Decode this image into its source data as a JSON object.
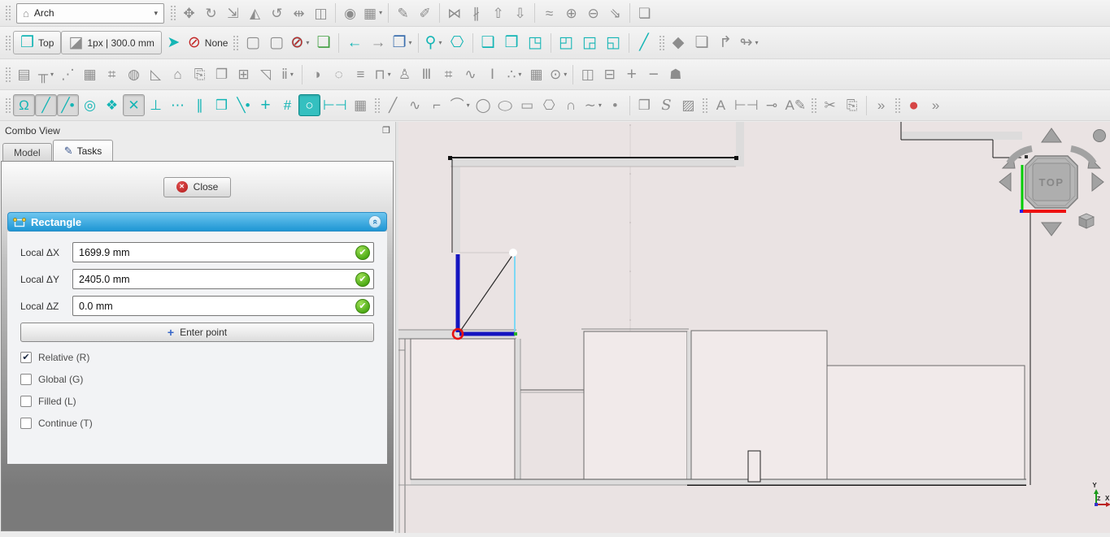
{
  "colors": {
    "teal": "#14b5b5",
    "header-blue1": "#6ec6ef",
    "header-blue2": "#1e96d4",
    "ok-green": "#4aa814",
    "record-red": "#d64545",
    "viewport-bg": "#eae3e3"
  },
  "toolbars": {
    "workbench_value": "Arch",
    "row1": [
      {
        "handle": true
      },
      {
        "name": "move-icon",
        "glyph": "✥"
      },
      {
        "name": "rotate-icon",
        "glyph": "↻"
      },
      {
        "name": "scale-icon",
        "glyph": "⇲"
      },
      {
        "name": "mirror-icon",
        "glyph": "◭"
      },
      {
        "name": "offset-icon",
        "glyph": "↺"
      },
      {
        "name": "trimex-icon",
        "glyph": "⇹"
      },
      {
        "name": "stretch-icon",
        "glyph": "◫"
      },
      {
        "sep": true
      },
      {
        "name": "clone-icon",
        "glyph": "◉"
      },
      {
        "name": "array-icon",
        "glyph": "▦",
        "dd": true
      },
      {
        "sep": true
      },
      {
        "name": "edit-icon",
        "glyph": "✎"
      },
      {
        "name": "subelement-icon",
        "glyph": "✐"
      },
      {
        "sep": true
      },
      {
        "name": "join-icon",
        "glyph": "⋈"
      },
      {
        "name": "split-icon",
        "glyph": "∦"
      },
      {
        "name": "upgrade-icon",
        "glyph": "⇧"
      },
      {
        "name": "downgrade-icon",
        "glyph": "⇩"
      },
      {
        "sep": true
      },
      {
        "name": "wire-to-bspline-icon",
        "glyph": "≈"
      },
      {
        "name": "add-point-icon",
        "glyph": "⊕"
      },
      {
        "name": "remove-point-icon",
        "glyph": "⊖"
      },
      {
        "name": "slope-icon",
        "glyph": "⇘"
      },
      {
        "sep": true
      },
      {
        "name": "shape-2d-view-icon",
        "glyph": "❏"
      }
    ],
    "row2": [
      {
        "handle": true
      },
      {
        "name": "view-top-button",
        "glyph": "❒",
        "label": "Top",
        "cls": "labeled teal-glyph"
      },
      {
        "name": "line-style-button",
        "glyph": "◪",
        "label": "1px | 300.0 mm",
        "cls": "labeled"
      },
      {
        "name": "apply-style-icon",
        "glyph": "➤",
        "cls": "teal-glyph"
      },
      {
        "name": "autogroup-button",
        "glyph": "⊘",
        "label": "None",
        "cls": "red-glyph"
      },
      {
        "handle": true
      },
      {
        "name": "select-bbox-icon",
        "glyph": "▢"
      },
      {
        "name": "select-element-icon",
        "glyph": "▢"
      },
      {
        "name": "clipping-off-icon",
        "glyph": "⊘",
        "cls": "clip",
        "dd": true
      },
      {
        "name": "pick-cube-icon",
        "glyph": "❏",
        "cls": "green-glyph"
      },
      {
        "sep": true
      },
      {
        "name": "nav-back-icon",
        "glyph": "←",
        "cls": "teal-glyph"
      },
      {
        "name": "nav-forward-icon",
        "glyph": "→"
      },
      {
        "name": "view-group-icon",
        "glyph": "❐",
        "cls": "blue-glyph",
        "dd": true
      },
      {
        "sep": true
      },
      {
        "name": "zoom-icon",
        "glyph": "⚲",
        "cls": "teal-glyph",
        "dd": true
      },
      {
        "name": "axonometric-view-icon",
        "glyph": "⎔",
        "cls": "teal-glyph"
      },
      {
        "sep": true
      },
      {
        "name": "view-front-icon",
        "glyph": "❑",
        "cls": "teal-glyph"
      },
      {
        "name": "view-top-cube-icon",
        "glyph": "❒",
        "cls": "teal-glyph"
      },
      {
        "name": "view-right-icon",
        "glyph": "◳",
        "cls": "teal-glyph"
      },
      {
        "sep": true
      },
      {
        "name": "view-rear-icon",
        "glyph": "◰",
        "cls": "teal-glyph"
      },
      {
        "name": "view-bottom-icon",
        "glyph": "◲",
        "cls": "teal-glyph"
      },
      {
        "name": "view-left-icon",
        "glyph": "◱",
        "cls": "teal-glyph"
      },
      {
        "sep": true
      },
      {
        "name": "measure-icon",
        "glyph": "╱",
        "cls": "teal-glyph"
      },
      {
        "handle": true
      },
      {
        "name": "part-icon",
        "glyph": "◆"
      },
      {
        "name": "new-folder-icon",
        "glyph": "❏"
      },
      {
        "name": "export-icon",
        "glyph": "↱"
      },
      {
        "name": "share-icon",
        "glyph": "↬",
        "dd": true
      }
    ],
    "row3": [
      {
        "handle": true
      },
      {
        "name": "arch-wall-icon",
        "glyph": "▤"
      },
      {
        "name": "arch-structure-icon",
        "glyph": "╥",
        "dd": true
      },
      {
        "name": "arch-multimaterial-icon",
        "glyph": "⋰"
      },
      {
        "name": "arch-curtainwall-icon",
        "glyph": "▦"
      },
      {
        "name": "arch-buildingpart-icon",
        "glyph": "⌗"
      },
      {
        "name": "arch-project-icon",
        "glyph": "◍"
      },
      {
        "name": "arch-slab-icon",
        "glyph": "◺"
      },
      {
        "name": "arch-building-icon",
        "glyph": "⌂"
      },
      {
        "name": "arch-reference-icon",
        "glyph": "⎘"
      },
      {
        "name": "arch-drawing-view-icon",
        "glyph": "❐"
      },
      {
        "name": "arch-window-icon",
        "glyph": "⊞"
      },
      {
        "name": "arch-roof-icon",
        "glyph": "◹"
      },
      {
        "name": "arch-pipes-icon",
        "glyph": "ⅱ",
        "dd": true
      },
      {
        "sep": true
      },
      {
        "name": "arch-axis-icon",
        "glyph": "◑"
      },
      {
        "name": "arch-sectionplane-icon",
        "glyph": "◌"
      },
      {
        "name": "arch-stairs-icon",
        "glyph": "≡"
      },
      {
        "name": "arch-opening-icon",
        "glyph": "⊓",
        "dd": true
      },
      {
        "name": "arch-equipment-icon",
        "glyph": "♙"
      },
      {
        "name": "arch-column-grid-icon",
        "glyph": "Ⅲ"
      },
      {
        "name": "arch-fence-icon",
        "glyph": "⌗"
      },
      {
        "name": "arch-truss-icon",
        "glyph": "∿"
      },
      {
        "name": "arch-profile-icon",
        "glyph": "Ⅰ"
      },
      {
        "name": "arch-fittings-icon",
        "glyph": "∴",
        "dd": true
      },
      {
        "name": "arch-schedule-icon",
        "glyph": "▦"
      },
      {
        "name": "arch-pipe-icon",
        "glyph": "⊙",
        "dd": true
      },
      {
        "sep": true
      },
      {
        "name": "cut-plane-icon",
        "glyph": "◫"
      },
      {
        "name": "cut-line-icon",
        "glyph": "⊟"
      },
      {
        "name": "arch-add-icon",
        "glyph": "+",
        "cls": "big"
      },
      {
        "name": "arch-remove-icon",
        "glyph": "−",
        "cls": "big"
      },
      {
        "name": "arch-survey-icon",
        "glyph": "☗"
      }
    ],
    "row4": [
      {
        "handle": true
      },
      {
        "name": "snap-lock-icon",
        "glyph": "Ω",
        "cls": "teal",
        "pressed": true
      },
      {
        "name": "snap-endpoint-icon",
        "glyph": "╱",
        "cls": "teal",
        "pressed": true
      },
      {
        "name": "snap-midpoint-icon",
        "glyph": "╱•",
        "cls": "teal",
        "pressed": true
      },
      {
        "name": "snap-center-icon",
        "glyph": "◎",
        "cls": "teal"
      },
      {
        "name": "snap-angle-icon",
        "glyph": "❖",
        "cls": "teal"
      },
      {
        "name": "snap-intersection-icon",
        "glyph": "✕",
        "cls": "teal",
        "pressed": true
      },
      {
        "name": "snap-perpendicular-icon",
        "glyph": "⊥",
        "cls": "teal"
      },
      {
        "name": "snap-extension-icon",
        "glyph": "⋯",
        "cls": "teal"
      },
      {
        "name": "snap-parallel-icon",
        "glyph": "∥",
        "cls": "teal slant"
      },
      {
        "name": "snap-special-icon",
        "glyph": "❒",
        "cls": "teal"
      },
      {
        "name": "snap-near-icon",
        "glyph": "╲•",
        "cls": "teal"
      },
      {
        "name": "snap-ortho-icon",
        "glyph": "+",
        "cls": "teal big"
      },
      {
        "name": "snap-grid-icon",
        "glyph": "#",
        "cls": "teal"
      },
      {
        "name": "snap-workingplane-icon",
        "glyph": "○",
        "cls": "wp",
        "pressed": true
      },
      {
        "name": "snap-dimensions-icon",
        "glyph": "⊢⊣",
        "cls": "teal"
      },
      {
        "name": "toggle-grid-icon",
        "glyph": "▦"
      },
      {
        "handle": true
      },
      {
        "name": "draft-line-icon",
        "glyph": "╱"
      },
      {
        "name": "draft-wire-icon",
        "glyph": "∿"
      },
      {
        "name": "draft-fillet-icon",
        "glyph": "⌐"
      },
      {
        "name": "draft-arc-icon",
        "glyph": "⌒",
        "dd": true
      },
      {
        "name": "draft-circle-icon",
        "glyph": "◯"
      },
      {
        "name": "draft-ellipse-icon",
        "glyph": "◯",
        "cls": "squash"
      },
      {
        "name": "draft-rectangle-icon",
        "glyph": "▭"
      },
      {
        "name": "draft-polygon-icon",
        "glyph": "⎔"
      },
      {
        "name": "draft-bspline-icon",
        "glyph": "∩"
      },
      {
        "name": "draft-bezier-icon",
        "glyph": "∼",
        "dd": true
      },
      {
        "name": "draft-point-icon",
        "glyph": "•"
      },
      {
        "sep": true
      },
      {
        "name": "draft-facebinder-icon",
        "glyph": "❒"
      },
      {
        "name": "draft-shapestring-icon",
        "glyph": "S",
        "cls": "serif-it"
      },
      {
        "name": "draft-hatch-icon",
        "glyph": "▨"
      },
      {
        "handle": true
      },
      {
        "name": "draft-text-icon",
        "glyph": "A"
      },
      {
        "name": "draft-dimension-icon",
        "glyph": "⊢⊣"
      },
      {
        "name": "draft-label-icon",
        "glyph": "⊸"
      },
      {
        "name": "annotation-styles-icon",
        "glyph": "A✎"
      },
      {
        "handle": true
      },
      {
        "name": "cut-icon",
        "glyph": "✂"
      },
      {
        "name": "copy-icon",
        "glyph": "⎘"
      },
      {
        "sep": true
      },
      {
        "name": "toolbar-overflow-icon",
        "glyph": "»"
      },
      {
        "handle": true
      },
      {
        "name": "macro-record-icon",
        "glyph": "●",
        "cls": "record"
      },
      {
        "name": "toolbar-overflow2-icon",
        "glyph": "»"
      }
    ]
  },
  "combo_view": {
    "title": "Combo View",
    "float_icon": "❐",
    "tabs": [
      {
        "name": "tab-model",
        "label": "Model"
      },
      {
        "name": "tab-tasks",
        "label": "Tasks",
        "icon": "✎",
        "active": true
      }
    ],
    "close_label": "Close",
    "close_icon": "✕",
    "task": {
      "section_title": "Rectangle",
      "collapse_glyph": "«",
      "fields": [
        {
          "name": "local-dx-field",
          "label": "Local ΔX",
          "value": "1699.9 mm",
          "ok_glyph": "✔"
        },
        {
          "name": "local-dy-field",
          "label": "Local ΔY",
          "value": "2405.0 mm",
          "ok_glyph": "✔"
        },
        {
          "name": "local-dz-field",
          "label": "Local ΔZ",
          "value": "0.0 mm",
          "ok_glyph": "✔"
        }
      ],
      "enter_point_label": "Enter point",
      "enter_point_icon": "+",
      "checkboxes": [
        {
          "name": "relative-checkbox",
          "label": "Relative (R)",
          "checked": true,
          "check_glyph": "✔"
        },
        {
          "name": "global-checkbox",
          "label": "Global (G)"
        },
        {
          "name": "filled-checkbox",
          "label": "Filled (L)"
        },
        {
          "name": "continue-checkbox",
          "label": "Continue (T)"
        }
      ]
    }
  },
  "viewport": {
    "cube_label": "TOP",
    "axis_x": "X",
    "axis_y": "Y",
    "axis_z": "Z"
  }
}
